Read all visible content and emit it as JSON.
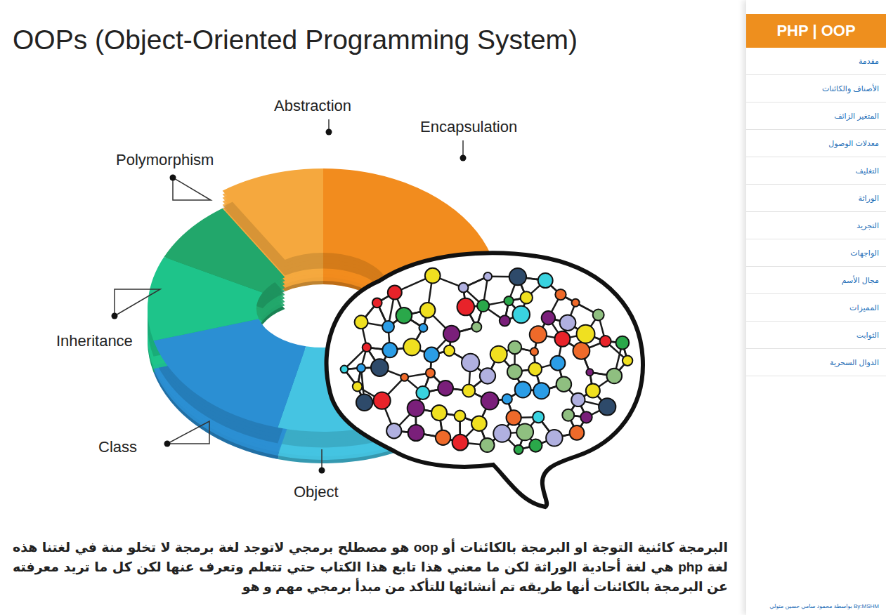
{
  "figure": {
    "title": "OOPs (Object-Oriented Programming System)",
    "segments": [
      {
        "label": "Abstraction",
        "color": "#f5a83e"
      },
      {
        "label": "Encapsulation",
        "color": "#f28c1e"
      },
      {
        "label": "Object",
        "color": "#45c4e2"
      },
      {
        "label": "Class",
        "color": "#2b8fd3"
      },
      {
        "label": "Inheritance",
        "color": "#1ec48a"
      },
      {
        "label": "Polymorphism",
        "color": "#22a76b"
      }
    ]
  },
  "article": {
    "paragraph": "البرمجة كائنية التوجة او البرمجة بالكائنات أو oop هو مصطلح برمجي لاتوجد لغة برمجة لا تخلو منة في لغتنا هذه لغة php هي لغة أحادية الوراثة لكن ما معني هذا تابع هذا الكتاب حتي تتعلم وتعرف عنها لكن كل ما تريد معرفته عن البرمجة بالكائنات أنها طريقه تم أنشائها للتأكد من مبدأ برمجي مهم و هو"
  },
  "sidebar": {
    "title": "PHP | OOP",
    "items": [
      {
        "label": "مقدمة",
        "selected": false
      },
      {
        "label": "الأصناف والكائنات",
        "selected": false
      },
      {
        "label": "المتغير الزائف",
        "selected": false
      },
      {
        "label": "معدلات الوصول",
        "selected": false
      },
      {
        "label": "التغليف",
        "selected": false
      },
      {
        "label": "الوراثة",
        "selected": false
      },
      {
        "label": "التجريد",
        "selected": false
      },
      {
        "label": "الواجهات",
        "selected": false
      },
      {
        "label": "مجال الأسم",
        "selected": false
      },
      {
        "label": "المميزات",
        "selected": false
      },
      {
        "label": "الثوابت",
        "selected": false
      },
      {
        "label": "الدوال السحرية",
        "selected": false
      }
    ],
    "footer": "By:MSHM بواسطة محمود سامي حسين متولي"
  }
}
